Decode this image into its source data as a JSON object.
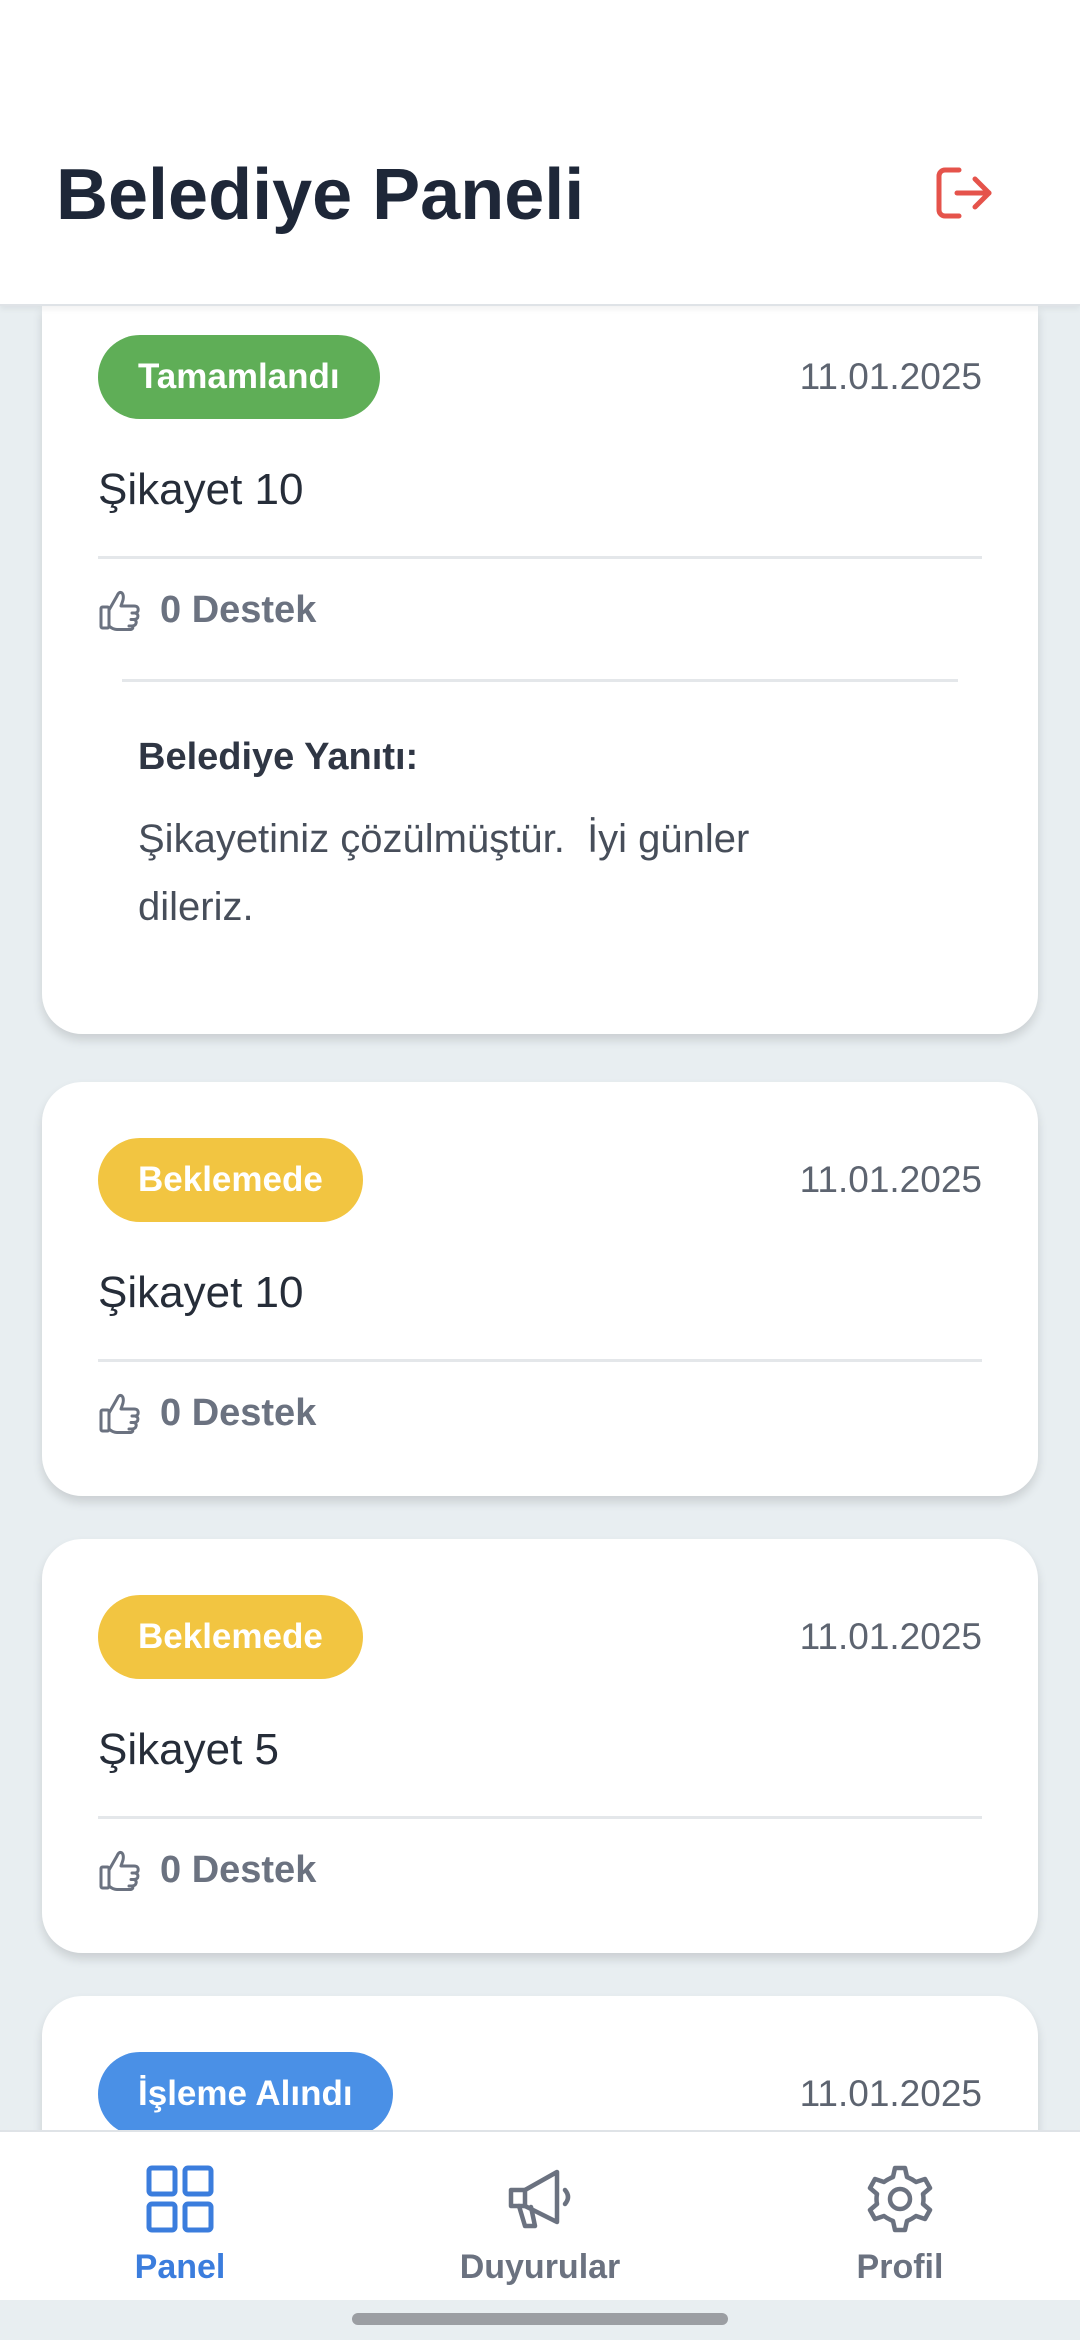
{
  "header": {
    "title": "Belediye Paneli",
    "logout_icon": "logout-icon",
    "logout_color": "#e5534b"
  },
  "status_colors": {
    "Tamamlandı": "#5fae57",
    "Beklemede": "#f2c541",
    "İşleme Alındı": "#4a90e6"
  },
  "complaints": [
    {
      "status": "Tamamlandı",
      "date": "11.01.2025",
      "title": "Şikayet 10",
      "support": "0 Destek",
      "reply_heading": "Belediye Yanıtı:",
      "reply_text": "Şikayetiniz çözülmüştür.  İyi günler\ndileriz."
    },
    {
      "status": "Beklemede",
      "date": "11.01.2025",
      "title": "Şikayet 10",
      "support": "0 Destek"
    },
    {
      "status": "Beklemede",
      "date": "11.01.2025",
      "title": "Şikayet 5",
      "support": "0 Destek"
    },
    {
      "status": "İşleme Alındı",
      "date": "11.01.2025"
    }
  ],
  "bottom_nav": {
    "items": [
      {
        "label": "Panel",
        "icon": "grid-icon",
        "active": true
      },
      {
        "label": "Duyurular",
        "icon": "megaphone-icon",
        "active": false
      },
      {
        "label": "Profil",
        "icon": "gear-icon",
        "active": false
      }
    ],
    "active_color": "#3b7ddd",
    "inactive_color": "#6b7280"
  }
}
